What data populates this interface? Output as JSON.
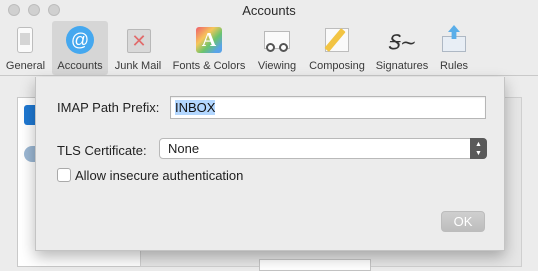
{
  "window": {
    "title": "Accounts"
  },
  "toolbar": {
    "items": [
      {
        "label": "General",
        "icon": "general-icon"
      },
      {
        "label": "Accounts",
        "icon": "at-sign-icon",
        "selected": true
      },
      {
        "label": "Junk Mail",
        "icon": "trash-icon"
      },
      {
        "label": "Fonts & Colors",
        "icon": "fonts-colors-icon"
      },
      {
        "label": "Viewing",
        "icon": "glasses-icon"
      },
      {
        "label": "Composing",
        "icon": "pencil-icon"
      },
      {
        "label": "Signatures",
        "icon": "signature-icon"
      },
      {
        "label": "Rules",
        "icon": "rules-icon"
      }
    ]
  },
  "sheet": {
    "imap_path_label": "IMAP Path Prefix:",
    "imap_path_value": "INBOX",
    "tls_label": "TLS Certificate:",
    "tls_value": "None",
    "insecure_auth_label": "Allow insecure authentication",
    "insecure_auth_checked": false,
    "ok_label": "OK"
  },
  "colors": {
    "accent": "#45a8ef",
    "selection": "#b3d7ff"
  }
}
